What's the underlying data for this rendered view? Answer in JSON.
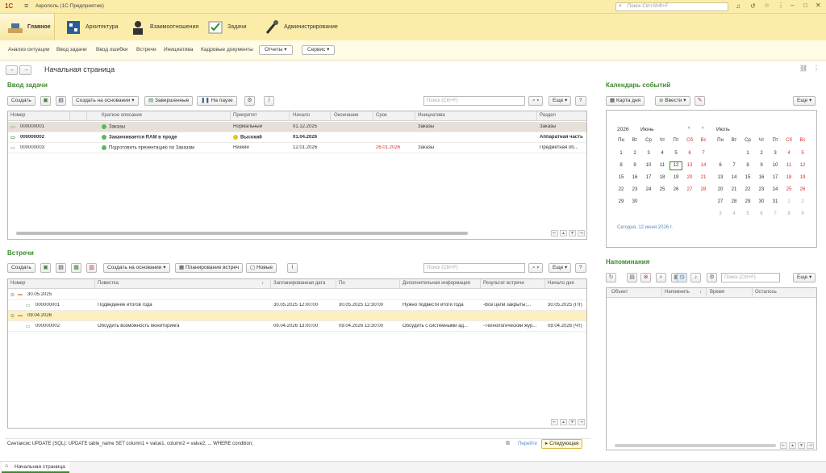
{
  "window": {
    "title": "Акрополь  (1С:Предприятие)",
    "search_placeholder": "Поиск Ctrl+Shift+F"
  },
  "sections": [
    {
      "label": "Главное"
    },
    {
      "label": "Архитектура"
    },
    {
      "label": "Взаимоотношения"
    },
    {
      "label": "Задачи"
    },
    {
      "label": "Администрирование"
    }
  ],
  "nav": {
    "items": [
      "Анализ ситуации",
      "Ввод задачи",
      "Ввод ошибки",
      "Встречи",
      "Инициатива",
      "Кадровые документы"
    ],
    "reports": "Отчеты",
    "service": "Сервис"
  },
  "page": {
    "title": "Начальная страница"
  },
  "tasks": {
    "title": "Ввод задачи",
    "buttons": {
      "create": "Создать",
      "create_based": "Создать на основании",
      "completed": "Завершенные",
      "paused": "На паузе",
      "more": "Еще",
      "help": "?"
    },
    "search_placeholder": "Поиск (Ctrl+F)",
    "columns": [
      "Номер",
      "Краткое описание",
      "Приоритет",
      "Начало",
      "Окончание",
      "Срок",
      "Инициатива",
      "Раздел"
    ],
    "rows": [
      {
        "num": "000000001",
        "desc": "Заказы",
        "priority": "Нормальный",
        "start": "01.12.2025",
        "end": "",
        "due": "",
        "initiative": "Заказы",
        "section": "Заказы"
      },
      {
        "num": "000000002",
        "desc": "Заканчивается RAM в проде",
        "priority": "Высокий",
        "start": "01.04.2026",
        "end": "",
        "due": "",
        "initiative": "",
        "section": "Аппаратная часть"
      },
      {
        "num": "000000003",
        "desc": "Подготовить презентацию по Заказам",
        "priority": "Низкий",
        "start": "12.01.2026",
        "end": "",
        "due": "26.01.2026",
        "initiative": "Заказы",
        "section": "Предметная об..."
      }
    ]
  },
  "meetings": {
    "title": "Встречи",
    "buttons": {
      "create": "Создать",
      "create_based": "Создать на основании",
      "planning": "Планирование встреч",
      "new": "Новые",
      "more": "Еще",
      "help": "?"
    },
    "search_placeholder": "Поиск (Ctrl+F)",
    "columns": [
      "Номер",
      "Повестка",
      "Запланированная дата",
      "По",
      "Дополнительная информация",
      "Результат встречи",
      "Начало дня"
    ],
    "groups": [
      {
        "date": "30.05.2025",
        "rows": [
          {
            "num": "000000001",
            "agenda": "Подведение итогов года",
            "planned": "30.05.2025 12:00:00",
            "to": "30.05.2025 12:30:00",
            "info": "Нужно подвести итоги года",
            "result": "-Все цели закрыты;...",
            "day_start": "30.05.2025 (Пт)"
          }
        ]
      },
      {
        "date": "09.04.2026",
        "rows": [
          {
            "num": "000000002",
            "agenda": "Обсудить возможность мониторинга",
            "planned": "09.04.2026 13:00:00",
            "to": "09.04.2026 13:30:00",
            "info": "Обсудить с системными ад...",
            "result": "-Технологический жур...",
            "day_start": "09.04.2026 (Чт)"
          }
        ]
      }
    ]
  },
  "tip": {
    "text": "Синтаксис UPDATE (SQL): UPDATE table_name SET column1 = value1, column2 = value2, ... WHERE condition;",
    "prev": "Перейти",
    "next": "Следующая"
  },
  "calendar": {
    "title": "Календарь событий",
    "buttons": {
      "map": "Карта дня",
      "add": "Ввести",
      "more": "Еще"
    },
    "left": {
      "year": "2026",
      "month": "Июнь"
    },
    "right": {
      "month": "Июль"
    },
    "weekdays": [
      "Пн",
      "Вт",
      "Ср",
      "Чт",
      "Пт",
      "Сб",
      "Вс"
    ],
    "today_link": "Сегодня, 12 июня 2026 г.",
    "june": [
      [
        "1",
        "2",
        "3",
        "4",
        "5",
        "6",
        "7"
      ],
      [
        "8",
        "9",
        "10",
        "11",
        "12",
        "13",
        "14"
      ],
      [
        "15",
        "16",
        "17",
        "18",
        "19",
        "20",
        "21"
      ],
      [
        "22",
        "23",
        "24",
        "25",
        "26",
        "27",
        "28"
      ],
      [
        "29",
        "30",
        "",
        "",
        "",
        "",
        ""
      ]
    ],
    "july": [
      [
        "",
        "",
        "1",
        "2",
        "3",
        "4",
        "5"
      ],
      [
        "6",
        "7",
        "8",
        "9",
        "10",
        "11",
        "12"
      ],
      [
        "13",
        "14",
        "15",
        "16",
        "17",
        "18",
        "19"
      ],
      [
        "20",
        "21",
        "22",
        "23",
        "24",
        "25",
        "26"
      ],
      [
        "27",
        "28",
        "29",
        "30",
        "31",
        "1",
        "2"
      ],
      [
        "3",
        "4",
        "5",
        "6",
        "7",
        "8",
        "9"
      ]
    ]
  },
  "reminders": {
    "title": "Напоминания",
    "search_placeholder": "Поиск (Ctrl+F)",
    "more": "Еще",
    "columns": [
      "Объект",
      "Напомнить",
      "Время",
      "Осталось"
    ]
  },
  "footer": {
    "tab": "Начальная страница"
  },
  "colors": {
    "accent_green": "#3c8a2e",
    "header_yellow": "#fbeda9",
    "highlight_row": "#fdf0c0",
    "selected_row": "#e8e2d8"
  }
}
